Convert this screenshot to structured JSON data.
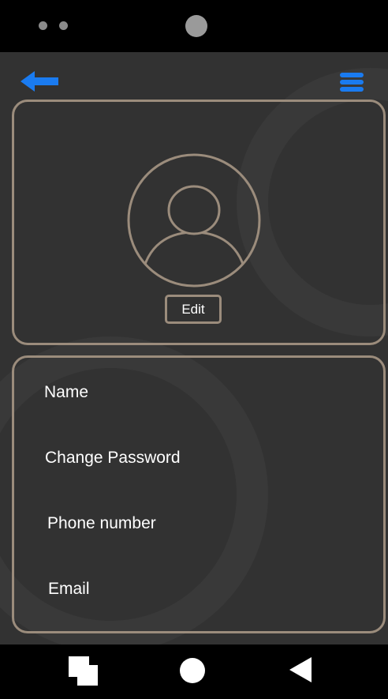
{
  "status_bar": {
    "icons": [
      "sensor-dot-icon",
      "sensor-dot-icon",
      "front-camera-icon"
    ]
  },
  "header": {
    "back_icon": "arrow-left-icon",
    "menu_icon": "hamburger-menu-icon",
    "accent_color": "#1a7bf0"
  },
  "profile": {
    "avatar_icon": "user-avatar-icon",
    "edit_label": "Edit"
  },
  "settings": {
    "items": [
      {
        "label": "Name"
      },
      {
        "label": "Change Password"
      },
      {
        "label": "Phone number"
      },
      {
        "label": "Email"
      }
    ]
  },
  "navbar": {
    "icons": [
      "recent-apps-icon",
      "home-icon",
      "back-triangle-icon"
    ]
  },
  "colors": {
    "screen_bg": "#323232",
    "card_border": "#9b8c7c",
    "text": "#ffffff",
    "device_frame": "#000000"
  }
}
